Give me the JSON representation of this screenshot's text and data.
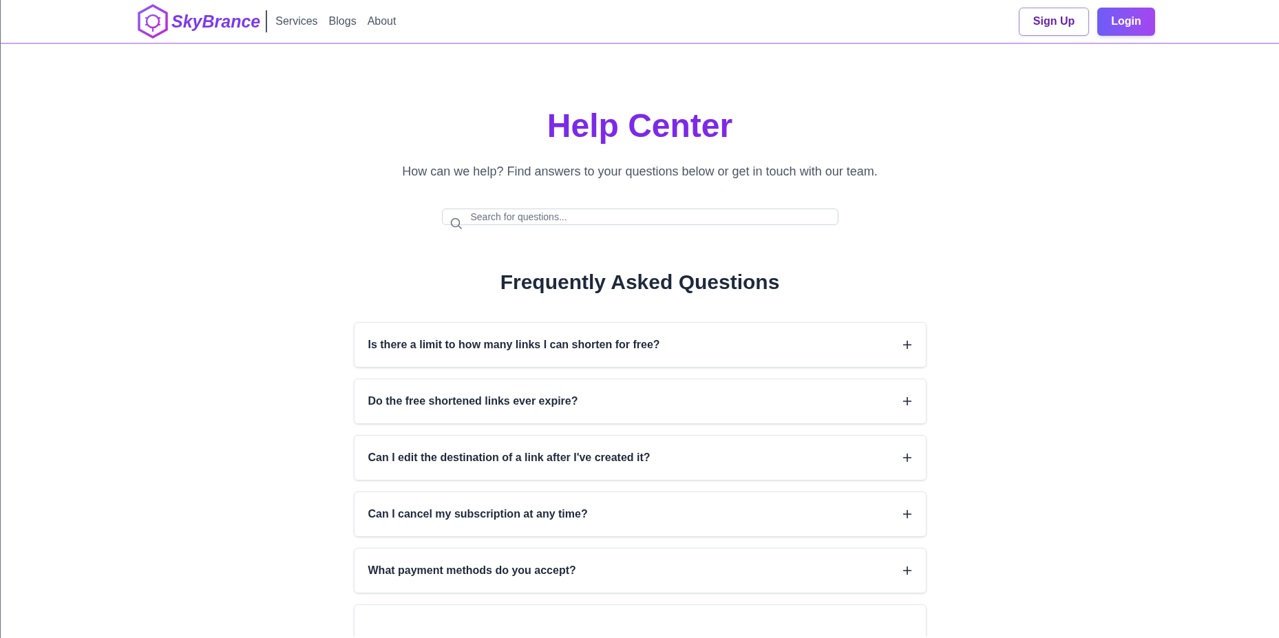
{
  "header": {
    "logo_text": "SkyBrance",
    "nav": [
      "Services",
      "Blogs",
      "About"
    ],
    "buttons": [
      "Sign Up",
      "Login"
    ]
  },
  "hero": {
    "title": "Help Center",
    "subtitle": "How can we help? Find answers to your questions below or get in touch with our team.",
    "search": {
      "placeholder": "Search for questions..."
    }
  },
  "faq": {
    "heading": "Frequently Asked Questions",
    "items": [
      {
        "question": "Is there a limit to how many links I can shorten for free?",
        "expanded": false
      },
      {
        "question": "Do the free shortened links ever expire?",
        "expanded": false
      },
      {
        "question": "Can I edit the destination of a link after I've created it?",
        "expanded": false
      },
      {
        "question": "Can I cancel my subscription at any time?",
        "expanded": false
      },
      {
        "question": "What payment methods do you accept?",
        "expanded": false
      }
    ]
  }
}
